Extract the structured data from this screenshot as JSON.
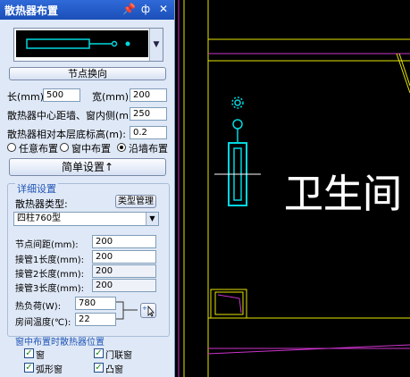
{
  "window": {
    "title": "散热器布置",
    "buttons": {
      "pin": "📌",
      "float": "ф",
      "close": "✕"
    }
  },
  "preview": {
    "dropdown_arrow": "▼"
  },
  "node_reverse_label": "节点换向",
  "fields": {
    "length_label": "长(mm):",
    "length_value": "500",
    "width_label": "宽(mm):",
    "width_value": "200",
    "center_dist_label": "散热器中心距墙、窗内侧(mm):",
    "center_dist_value": "250",
    "relative_height_label": "散热器相对本层底标高(m):",
    "relative_height_value": "0.2"
  },
  "placement": {
    "options": [
      "任意布置",
      "窗中布置",
      "沿墙布置"
    ],
    "selected": 2
  },
  "simple_settings_label": "简单设置↑",
  "detail": {
    "title": "详细设置",
    "type_label": "散热器类型:",
    "type_manage_label": "类型管理",
    "type_value": "四柱760型",
    "node_spacing_label": "节点间距(mm):",
    "node_spacing_value": "200",
    "pipe1_label": "接管1长度(mm):",
    "pipe1_value": "200",
    "pipe2_label": "接管2长度(mm):",
    "pipe2_value": "200",
    "pipe3_label": "接管3长度(mm):",
    "pipe3_value": "200",
    "heat_load_label": "热负荷(W):",
    "heat_load_value": "780",
    "room_temp_label": "房间温度(℃):",
    "room_temp_value": "22"
  },
  "window_position": {
    "title": "窗中布置时散热器位置",
    "options": [
      {
        "label": "窗",
        "checked": true
      },
      {
        "label": "门联窗",
        "checked": true
      },
      {
        "label": "弧形窗",
        "checked": true
      },
      {
        "label": "凸窗",
        "checked": true
      }
    ]
  },
  "canvas": {
    "room_label": "卫生间"
  },
  "colors": {
    "cad_background": "#000000",
    "yellow_lines": "#e6e600",
    "magenta_lines": "#cc33cc",
    "cyan_radiator": "#00d8e0",
    "panel_background": "#dfe8f6"
  }
}
